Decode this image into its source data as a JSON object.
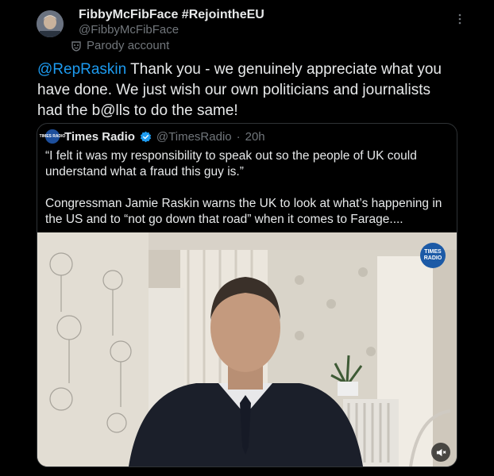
{
  "post": {
    "display_name": "FibbyMcFibFace #RejointheEU",
    "handle": "@FibbyMcFibFace",
    "label": "Parody account",
    "mention": "@RepRaskin",
    "text": " Thank you - we genuinely appreciate what you have done. We just wish our own politicians and journalists had the b@lls to do the same!"
  },
  "quoted": {
    "name": "Times Radio",
    "handle": "@TimesRadio",
    "separator": "·",
    "time": "20h",
    "logo_text": "TIMES RADIO",
    "text": "“I felt it was my responsibility to speak out so the people of UK could understand what a fraud this guy is.”\n\nCongressman Jamie Raskin warns the UK to look at what’s happening in the US and to “not go down that road” when it comes to Farage...."
  },
  "video": {
    "badge": "TIMES RADIO",
    "muted": true
  },
  "icons": {
    "more": "more-icon",
    "parody": "parody-mask-icon",
    "verified": "verified-badge-icon",
    "mute": "speaker-muted-icon"
  },
  "colors": {
    "background": "#000000",
    "text": "#e7e9ea",
    "secondary": "#71767b",
    "link": "#1d9bf0",
    "verified": "#1d9bf0",
    "border": "#2f3336"
  }
}
